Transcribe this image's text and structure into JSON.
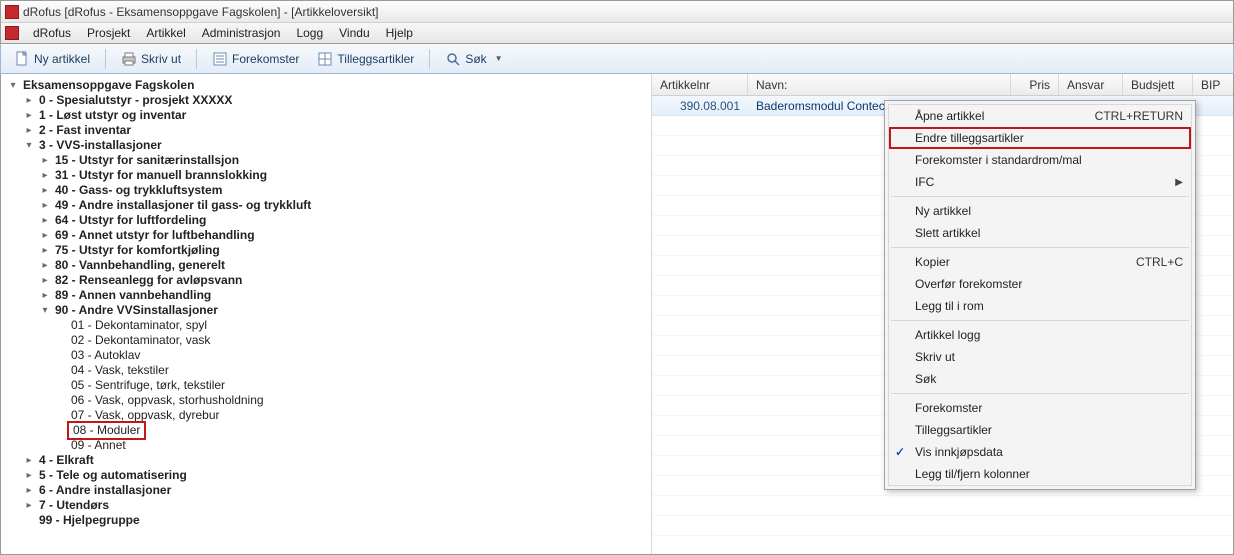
{
  "window": {
    "title": "dRofus [dRofus - Eksamensoppgave Fagskolen] - [Artikkeloversikt]"
  },
  "menu": {
    "items": [
      "dRofus",
      "Prosjekt",
      "Artikkel",
      "Administrasjon",
      "Logg",
      "Vindu",
      "Hjelp"
    ]
  },
  "toolbar": {
    "new_article": "Ny artikkel",
    "print": "Skriv ut",
    "occurrences": "Forekomster",
    "addon_articles": "Tilleggsartikler",
    "search": "Søk"
  },
  "tree": {
    "root": "Eksamensoppgave Fagskolen",
    "n0": "0 - Spesialutstyr - prosjekt XXXXX",
    "n1": "1 - Løst utstyr og inventar",
    "n2": "2 - Fast inventar",
    "n3": "3 - VVS-installasjoner",
    "n3_15": "15 - Utstyr for sanitærinstallsjon",
    "n3_31": "31 - Utstyr for manuell brannslokking",
    "n3_40": "40 - Gass- og trykkluftsystem",
    "n3_49": "49 - Andre installasjoner til gass- og trykkluft",
    "n3_64": "64 - Utstyr for luftfordeling",
    "n3_69": "69 - Annet utstyr for luftbehandling",
    "n3_75": "75 - Utstyr for komfortkjøling",
    "n3_80": "80 - Vannbehandling, generelt",
    "n3_82": "82 - Renseanlegg for avløpsvann",
    "n3_89": "89 - Annen vannbehandling",
    "n3_90": "90 - Andre VVSinstallasjoner",
    "n3_90_01": "01 - Dekontaminator, spyl",
    "n3_90_02": "02 - Dekontaminator, vask",
    "n3_90_03": "03 - Autoklav",
    "n3_90_04": "04 - Vask, tekstiler",
    "n3_90_05": "05 - Sentrifuge, tørk, tekstiler",
    "n3_90_06": "06 - Vask, oppvask, storhusholdning",
    "n3_90_07": "07 - Vask, oppvask, dyrebur",
    "n3_90_08": "08 - Moduler",
    "n3_90_09": "09 - Annet",
    "n4": "4 - Elkraft",
    "n5": "5 - Tele og automatisering",
    "n6": "6 - Andre installasjoner",
    "n7": "7 - Utendørs",
    "n99": "99 - Hjelpegruppe"
  },
  "grid": {
    "headers": {
      "c1": "Artikkelnr",
      "c2": "Navn:",
      "c3": "Pris",
      "c4": "Ansvar",
      "c5": "Budsjett",
      "c6": "BIP"
    },
    "row": {
      "artnr": "390.08.001",
      "navn": "Baderomsmodul Contech"
    }
  },
  "ctx": {
    "open": "Åpne artikkel",
    "open_sc": "CTRL+RETURN",
    "edit_addon": "Endre tilleggsartikler",
    "occ_std": "Forekomster i standardrom/mal",
    "ifc": "IFC",
    "new": "Ny artikkel",
    "delete": "Slett artikkel",
    "copy": "Kopier",
    "copy_sc": "CTRL+C",
    "transfer": "Overfør forekomster",
    "addroom": "Legg til i rom",
    "log": "Artikkel logg",
    "print": "Skriv ut",
    "search": "Søk",
    "occ": "Forekomster",
    "addon": "Tilleggsartikler",
    "show_purchase": "Vis innkjøpsdata",
    "columns": "Legg til/fjern kolonner"
  }
}
